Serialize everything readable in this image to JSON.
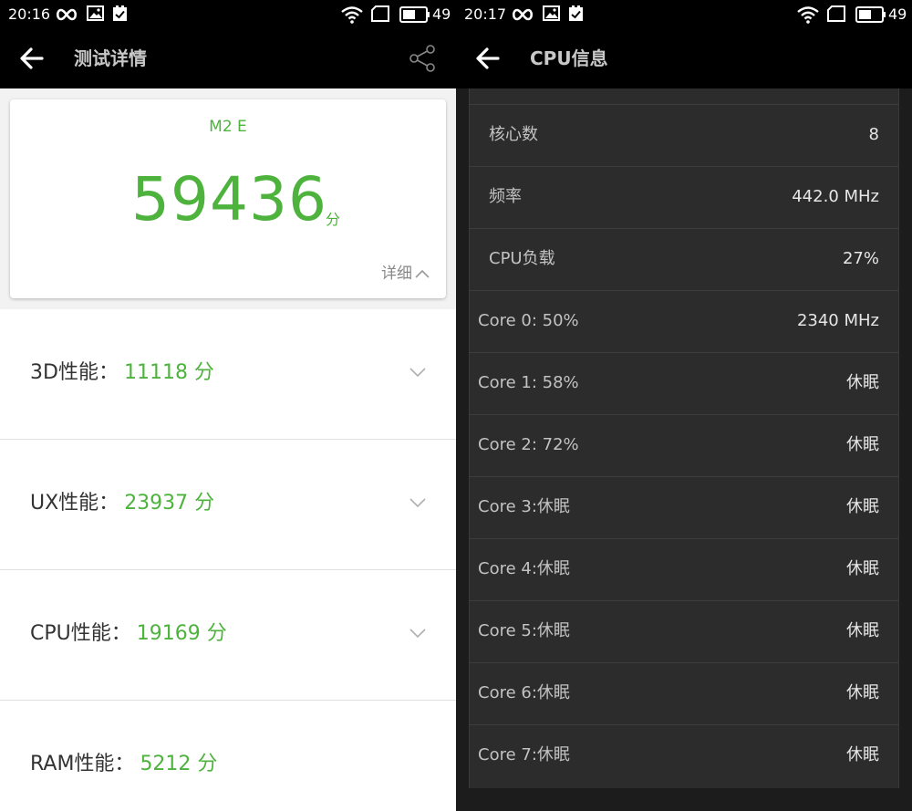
{
  "status_left": {
    "time": "20:16",
    "battery": "49"
  },
  "status_right": {
    "time": "20:17",
    "battery": "49"
  },
  "left_screen": {
    "title": "测试详情",
    "device": "M2 E",
    "total_score": "59436",
    "score_unit": "分",
    "detail_label": "详细",
    "items": [
      {
        "label": "3D性能：",
        "value": "11118 分"
      },
      {
        "label": "UX性能：",
        "value": "23937 分"
      },
      {
        "label": "CPU性能：",
        "value": "19169 分"
      },
      {
        "label": "RAM性能：",
        "value": "5212 分"
      }
    ]
  },
  "right_screen": {
    "title": "CPU信息",
    "rows": [
      {
        "label": "核心数",
        "value": "8"
      },
      {
        "label": "频率",
        "value": "442.0 MHz"
      },
      {
        "label": "CPU负载",
        "value": "27%"
      },
      {
        "label": "Core 0: 50%",
        "value": "2340 MHz"
      },
      {
        "label": "Core 1: 58%",
        "value": "休眠"
      },
      {
        "label": "Core 2: 72%",
        "value": "休眠"
      },
      {
        "label": "Core 3:休眠",
        "value": "休眠"
      },
      {
        "label": "Core 4:休眠",
        "value": "休眠"
      },
      {
        "label": "Core 5:休眠",
        "value": "休眠"
      },
      {
        "label": "Core 6:休眠",
        "value": "休眠"
      },
      {
        "label": "Core 7:休眠",
        "value": "休眠"
      }
    ]
  },
  "icons": [
    "infinity-icon",
    "image-notification-icon",
    "check-notification-icon",
    "wifi-icon",
    "sim-icon",
    "battery-icon",
    "back-arrow-icon",
    "share-icon",
    "chevron-up-icon",
    "chevron-down-icon"
  ],
  "colors": {
    "accent_green": "#4db33d",
    "bar_black": "#000000",
    "dark_list": "#2c2c2c"
  }
}
